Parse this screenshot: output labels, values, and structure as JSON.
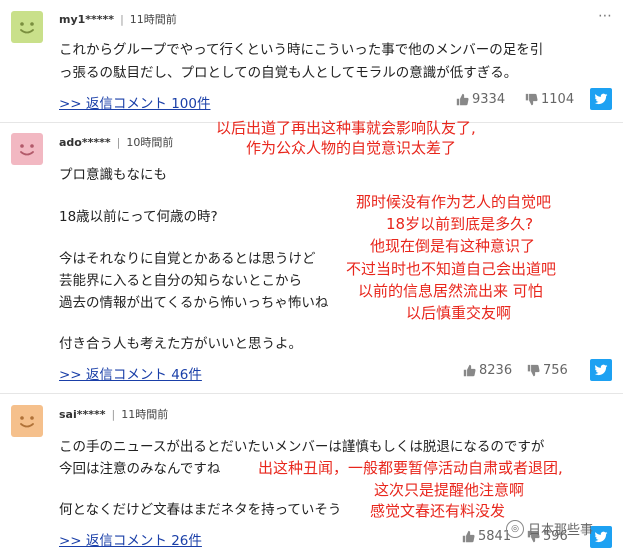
{
  "comments": [
    {
      "user": "my1*****",
      "separator": "|",
      "time": "11時間前",
      "avatar_color": "#c9e08a",
      "lines": [
        "これからグループでやって行くという時にこういった事で他のメンバーの足を引",
        "っ張るの駄目だし、プロとしての自覚も人としてモラルの意識が低すぎる。"
      ],
      "reply": ">> 返信コメント 100件",
      "likes": "9334",
      "dislikes": "1104"
    },
    {
      "user": "ado*****",
      "separator": "|",
      "time": "10時間前",
      "avatar_color": "#f2b8c2",
      "lines": [
        "プロ意識もなにも",
        "18歳以前にって何歳の時?",
        "今はそれなりに自覚とかあるとは思うけど",
        "芸能界に入ると自分の知らないとこから",
        "過去の情報が出てくるから怖いっちゃ怖いね",
        "付き合う人も考えた方がいいと思うよ。"
      ],
      "reply": ">> 返信コメント 46件",
      "likes": "8236",
      "dislikes": "756"
    },
    {
      "user": "sai*****",
      "separator": "|",
      "time": "11時間前",
      "avatar_color": "#f5c08c",
      "lines": [
        "この手のニュースが出るとだいたいメンバーは謹慎もしくは脱退になるのですが",
        "今回は注意のみなんですね",
        "何となくだけど文春はまだネタを持っていそう"
      ],
      "reply": ">> 返信コメント 26件",
      "likes": "5841",
      "dislikes": "596"
    }
  ],
  "more_icon": "ellipsis-icon",
  "annotations": {
    "note1": [
      "以后出道了再出这种事就会影响队友了,",
      "作为公众人物的自觉意识太差了"
    ],
    "note2": [
      "那时候没有作为艺人的自觉吧",
      "18岁以前到底是多久?",
      "他现在倒是有这种意识了",
      "不过当时也不知道自己会出道吧",
      "以前的信息居然流出来 可怕",
      "以后慎重交友啊"
    ],
    "note3": [
      "出这种丑闻，一般都要暂停活动自肃或者退团,",
      "这次只是提醒他注意啊",
      "感觉文春还有料没发"
    ],
    "color": "#e8261c"
  },
  "watermark": "日本那些事"
}
